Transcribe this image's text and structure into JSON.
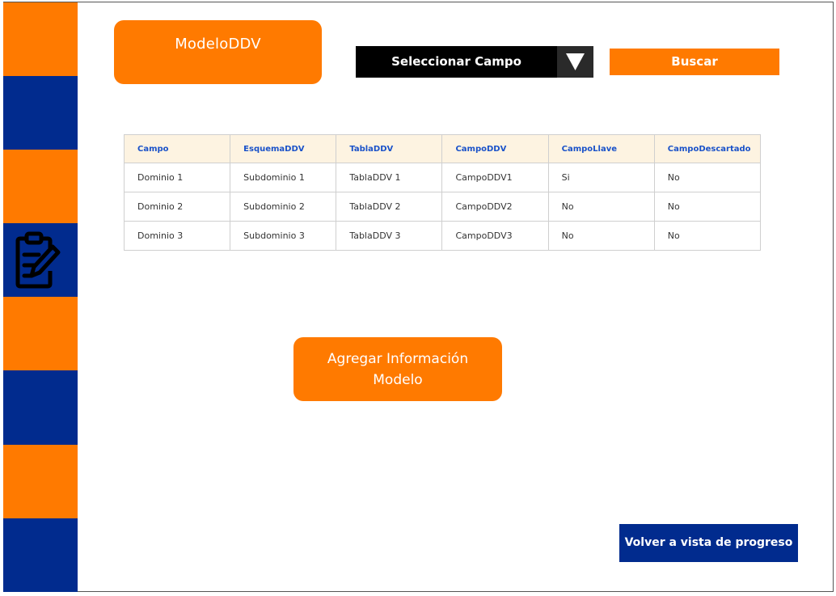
{
  "header": {
    "model_title": "ModeloDDV",
    "select": {
      "value": "Seleccionar Campo",
      "arrow_icon": "triangle-down-icon"
    },
    "search_label": "Buscar"
  },
  "sidebar": {
    "icon": "clipboard-edit-icon",
    "colors": {
      "orange": "#ff7a00",
      "blue": "#012b8e"
    }
  },
  "table": {
    "headers": [
      "Campo",
      "EsquemaDDV",
      "TablaDDV",
      "CampoDDV",
      "CampoLlave",
      "CampoDescartado"
    ],
    "rows": [
      [
        "Dominio 1",
        "Subdominio 1",
        "TablaDDV 1",
        "CampoDDV1",
        "Si",
        "No"
      ],
      [
        "Dominio 2",
        "Subdominio 2",
        "TablaDDV 2",
        "CampoDDV2",
        "No",
        "No"
      ],
      [
        "Dominio 3",
        "Subdominio 3",
        "TablaDDV 3",
        "CampoDDV3",
        "No",
        "No"
      ]
    ]
  },
  "actions": {
    "add_info_line1": "Agregar Información",
    "add_info_line2": "Modelo",
    "back_label": "Volver a vista de progreso"
  }
}
